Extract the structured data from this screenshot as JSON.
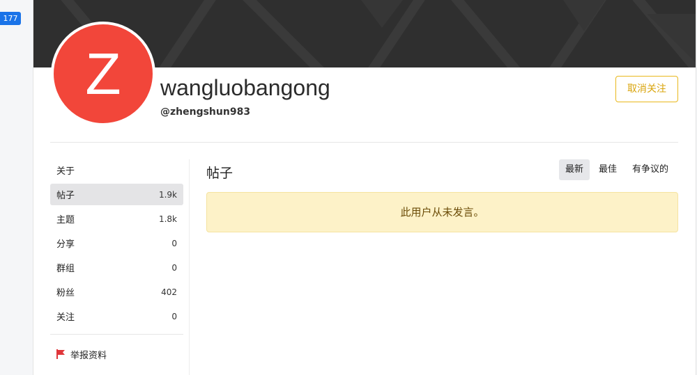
{
  "notification_count": "177",
  "profile": {
    "avatar_letter": "Z",
    "display_name": "wangluobangong",
    "handle": "@zhengshun983",
    "unfollow_label": "取消关注"
  },
  "sidebar": {
    "about_label": "关于",
    "items": [
      {
        "label": "帖子",
        "count": "1.9k"
      },
      {
        "label": "主题",
        "count": "1.8k"
      },
      {
        "label": "分享",
        "count": "0"
      },
      {
        "label": "群组",
        "count": "0"
      },
      {
        "label": "粉丝",
        "count": "402"
      },
      {
        "label": "关注",
        "count": "0"
      }
    ],
    "report_label": "举报资料"
  },
  "main": {
    "title": "帖子",
    "sort_tabs": [
      "最新",
      "最佳",
      "有争议的"
    ],
    "empty_message": "此用户从未发言。"
  },
  "colors": {
    "avatar": "#f2463a",
    "accent": "#e9b81b",
    "notice_bg": "#fdf2c8",
    "badge": "#1a73e8",
    "flag": "#e0363a"
  }
}
